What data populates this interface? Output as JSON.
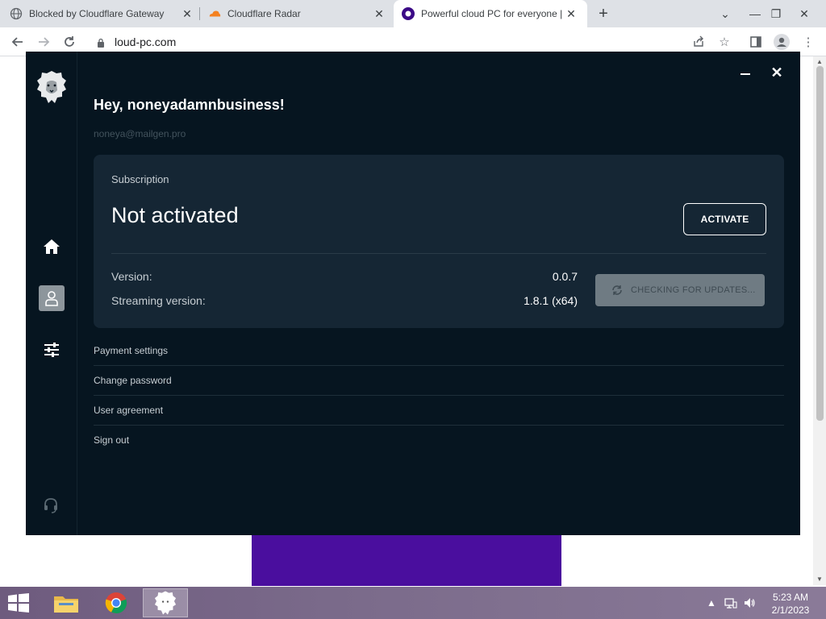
{
  "browser": {
    "tabs": [
      {
        "title": "Blocked by Cloudflare Gateway",
        "favicon": "globe-icon",
        "active": false
      },
      {
        "title": "Cloudflare Radar",
        "favicon": "cloudflare-icon",
        "active": false
      },
      {
        "title": "Powerful cloud PC for everyone |",
        "favicon": "cloud-pc-icon",
        "active": true
      }
    ],
    "new_tab_label": "+",
    "url": "loud-pc.com"
  },
  "app": {
    "greeting": "Hey, noneyadamnbusiness!",
    "email": "noneya@mailgen.pro",
    "subscription": {
      "label": "Subscription",
      "status": "Not activated",
      "activate_label": "ACTIVATE"
    },
    "versions": [
      {
        "label": "Version:",
        "value": "0.0.7"
      },
      {
        "label": "Streaming version:",
        "value": "1.8.1 (x64)"
      }
    ],
    "update_button_label": "CHECKING FOR UPDATES...",
    "menu": [
      {
        "label": "Payment settings"
      },
      {
        "label": "Change password"
      },
      {
        "label": "User agreement"
      },
      {
        "label": "Sign out"
      }
    ],
    "sidebar_icons": [
      "home-icon",
      "user-icon",
      "settings-sliders-icon",
      "support-headset-icon"
    ],
    "colors": {
      "background": "#061520",
      "card": "#152634",
      "accent_purple": "#4a0e9e"
    }
  },
  "taskbar": {
    "time": "5:23 AM",
    "date": "2/1/2023"
  }
}
